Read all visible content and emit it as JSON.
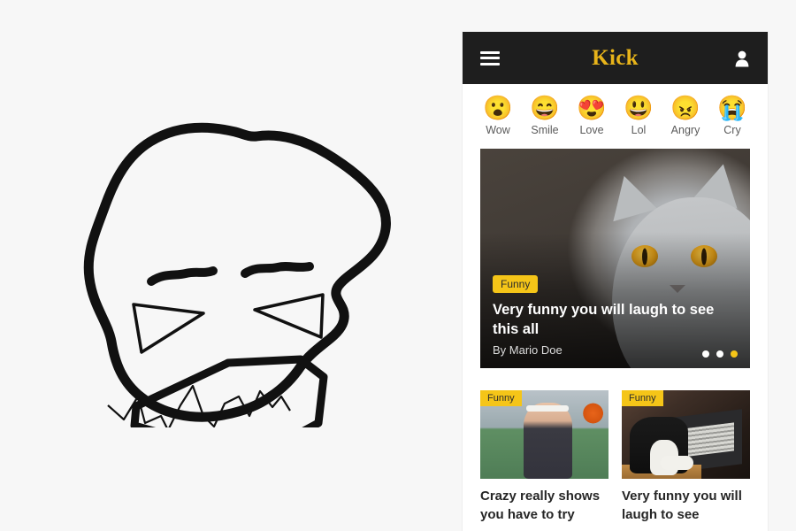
{
  "sketch": {
    "name": "hand-drawn-laughing-face",
    "description": "Hand drawn black outline troll style laughing face with squinting triangular eyes, thick wavy eyebrows and wide open mouth with zigzag teeth",
    "stroke_color": "#111111",
    "background": "#f7f7f7"
  },
  "phone": {
    "background": "#ffffff",
    "header": {
      "brand": "Kick",
      "brand_color": "#e8b41a",
      "background": "#1e1e1e",
      "menu_icon": "hamburger-icon",
      "account_icon": "user-account-icon"
    },
    "reactions": [
      {
        "emoji": "😮",
        "label": "Wow",
        "icon": "wow-emoji-icon"
      },
      {
        "emoji": "😄",
        "label": "Smile",
        "icon": "smile-emoji-icon"
      },
      {
        "emoji": "😍",
        "label": "Love",
        "icon": "love-emoji-icon"
      },
      {
        "emoji": "😃",
        "label": "Lol",
        "icon": "lol-emoji-icon"
      },
      {
        "emoji": "😠",
        "label": "Angry",
        "icon": "angry-emoji-icon"
      },
      {
        "emoji": "😭",
        "label": "Cry",
        "icon": "cry-emoji-icon"
      }
    ],
    "featured": {
      "badge": "Funny",
      "badge_color": "#f5c518",
      "title": "Very funny you will laugh to see this all",
      "author": "By Mario Doe",
      "image_alt": "grey british shorthair cat with amber eyes",
      "carousel": {
        "total": 3,
        "active_index": 2,
        "active_color": "#f5c518",
        "inactive_color": "#ffffff"
      }
    },
    "grid": [
      {
        "badge": "Funny",
        "title": "Crazy really shows you have to try",
        "image_alt": "basketball player meme on green court"
      },
      {
        "badge": "Funny",
        "title": "Very funny you will laugh to see",
        "image_alt": "tuxedo cat typing on a laptop"
      }
    ]
  }
}
